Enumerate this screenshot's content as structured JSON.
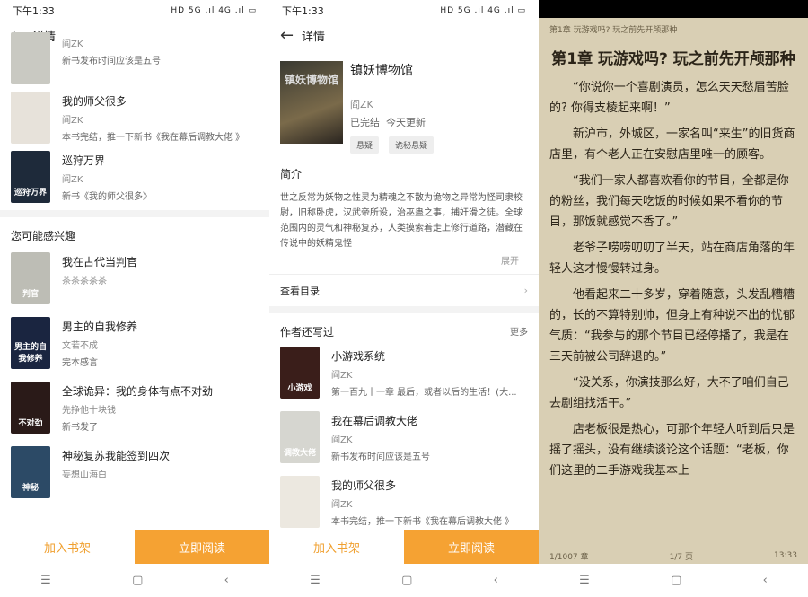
{
  "status": {
    "time": "下午1:33",
    "icons": "HD 5G .ıl 4G .ıl ▭"
  },
  "header": {
    "title": "详情"
  },
  "p1": {
    "books": [
      {
        "title": "",
        "author": "阎ZK",
        "desc": "新书发布时间应该是五号",
        "color": "#c9c9c2",
        "cov": ""
      },
      {
        "title": "我的师父很多",
        "author": "阎ZK",
        "desc": "本书完结，推一下新书《我在幕后调教大佬 》",
        "color": "#e7e2da",
        "cov": ""
      },
      {
        "title": "巡狩万界",
        "author": "阎ZK",
        "desc": "新书《我的师父很多》",
        "color": "#1e2a3a",
        "cov": "巡狩万界"
      }
    ],
    "section": "您可能感兴趣",
    "recs": [
      {
        "title": "我在古代当判官",
        "author": "茶茶茶茶茶",
        "desc": "",
        "color": "#bdbdb5",
        "cov": "判官"
      },
      {
        "title": "男主的自我修养",
        "author": "文若不成",
        "desc": "完本感言",
        "color": "#1a2540",
        "cov": "男主的自我修养"
      },
      {
        "title": "全球诡异：我的身体有点不对劲",
        "author": "先挣他十块钱",
        "desc": "新书发了",
        "color": "#2a1a18",
        "cov": "不对劲"
      },
      {
        "title": "神秘复苏我能签到四次",
        "author": "妄想山海白",
        "desc": "",
        "color": "#2c4a66",
        "cov": "神秘"
      }
    ]
  },
  "p2": {
    "book": {
      "title": "镇妖博物馆",
      "author": "阎ZK",
      "status": "已完结",
      "updated": "今天更新",
      "tags": [
        "悬疑",
        "诡秘悬疑"
      ],
      "cov": "镇妖博物馆"
    },
    "intro_label": "简介",
    "intro": "世之反常为妖物之性灵为精魂之不散为诡物之异常为怪司隶校尉，旧称卧虎，汉武帝所设，治巫蛊之事，捕奸滑之徒。全球范围内的灵气和神秘复苏，人类摸索着走上修行道路，潜藏在传说中的妖精鬼怪",
    "expand": "展开",
    "toc": "查看目录",
    "author_section": "作者还写过",
    "more": "更多",
    "books": [
      {
        "title": "小游戏系统",
        "author": "阎ZK",
        "desc": "第一百九十一章 最后，或者以后的生活！(大...",
        "color": "#3a1e1a",
        "cov": "小游戏"
      },
      {
        "title": "我在幕后调教大佬",
        "author": "阎ZK",
        "desc": "新书发布时间应该是五号",
        "color": "#d6d6d0",
        "cov": "调教大佬"
      },
      {
        "title": "我的师父很多",
        "author": "阎ZK",
        "desc": "本书完结，推一下新书《我在幕后调教大佬 》",
        "color": "#ece8e0",
        "cov": ""
      }
    ]
  },
  "buttons": {
    "add": "加入书架",
    "read": "立即阅读"
  },
  "nav": {
    "menu": "☰",
    "home": "▢",
    "back": "‹"
  },
  "reader": {
    "top": "第1章 玩游戏吗? 玩之前先开颅那种",
    "title": "第1章 玩游戏吗? 玩之前先开颅那种",
    "paras": [
      "“你说你一个喜剧演员，怎么天天愁眉苦脸的? 你得支棱起来啊！”",
      "新沪市，外城区，一家名叫“来生”的旧货商店里，有个老人正在安慰店里唯一的顾客。",
      "“我们一家人都喜欢看你的节目，全都是你的粉丝，我们每天吃饭的时候如果不看你的节目，那饭就感觉不香了。”",
      "老爷子唠唠叨叨了半天，站在商店角落的年轻人这才慢慢转过身。",
      "他看起来二十多岁，穿着随意，头发乱糟糟的，长的不算特别帅，但身上有种说不出的忧郁气质：“我参与的那个节目已经停播了，我是在三天前被公司辞退的。”",
      "“没关系，你演技那么好，大不了咱们自己去剧组找活干。”",
      "店老板很是热心，可那个年轻人听到后只是摇了摇头，没有继续谈论这个话题：“老板，你们这里的二手游戏我基本上"
    ],
    "chapter": "1/1007 章",
    "page": "1/7 页",
    "time": "13:33"
  }
}
